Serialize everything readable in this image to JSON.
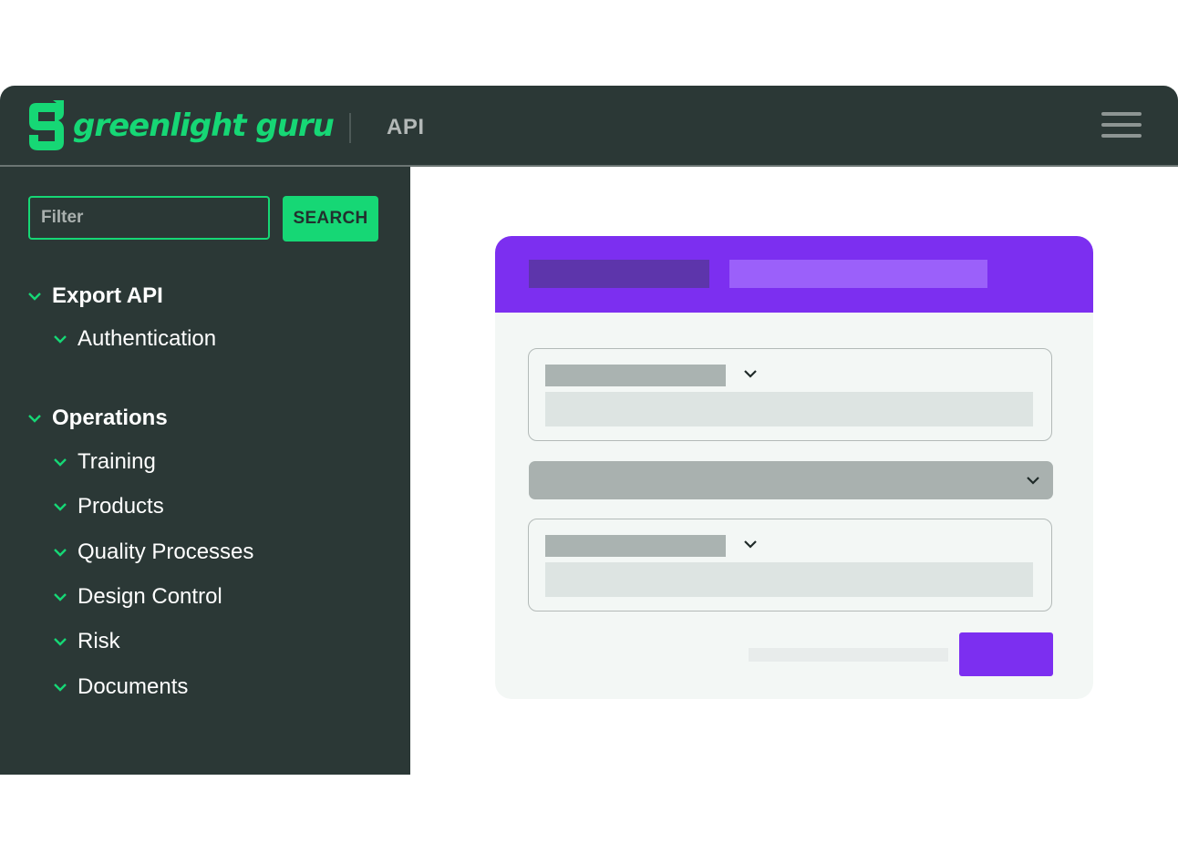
{
  "header": {
    "brand": "greenlight guru",
    "section_label": "API",
    "logo_icon": "greenlight-g-logo-icon",
    "menu_icon": "hamburger-menu-icon"
  },
  "sidebar": {
    "filter": {
      "placeholder": "Filter",
      "value": ""
    },
    "search_label": "SEARCH",
    "groups": [
      {
        "label": "Export API",
        "items": [
          "Authentication"
        ]
      },
      {
        "label": "Operations",
        "items": [
          "Training",
          "Products",
          "Quality Processes",
          "Design Control",
          "Risk",
          "Documents"
        ]
      }
    ],
    "expand_icon": "chevron-down-icon"
  },
  "colors": {
    "accent_green": "#16d775",
    "dark_background": "#2b3836",
    "purple": "#7c2ff0"
  }
}
